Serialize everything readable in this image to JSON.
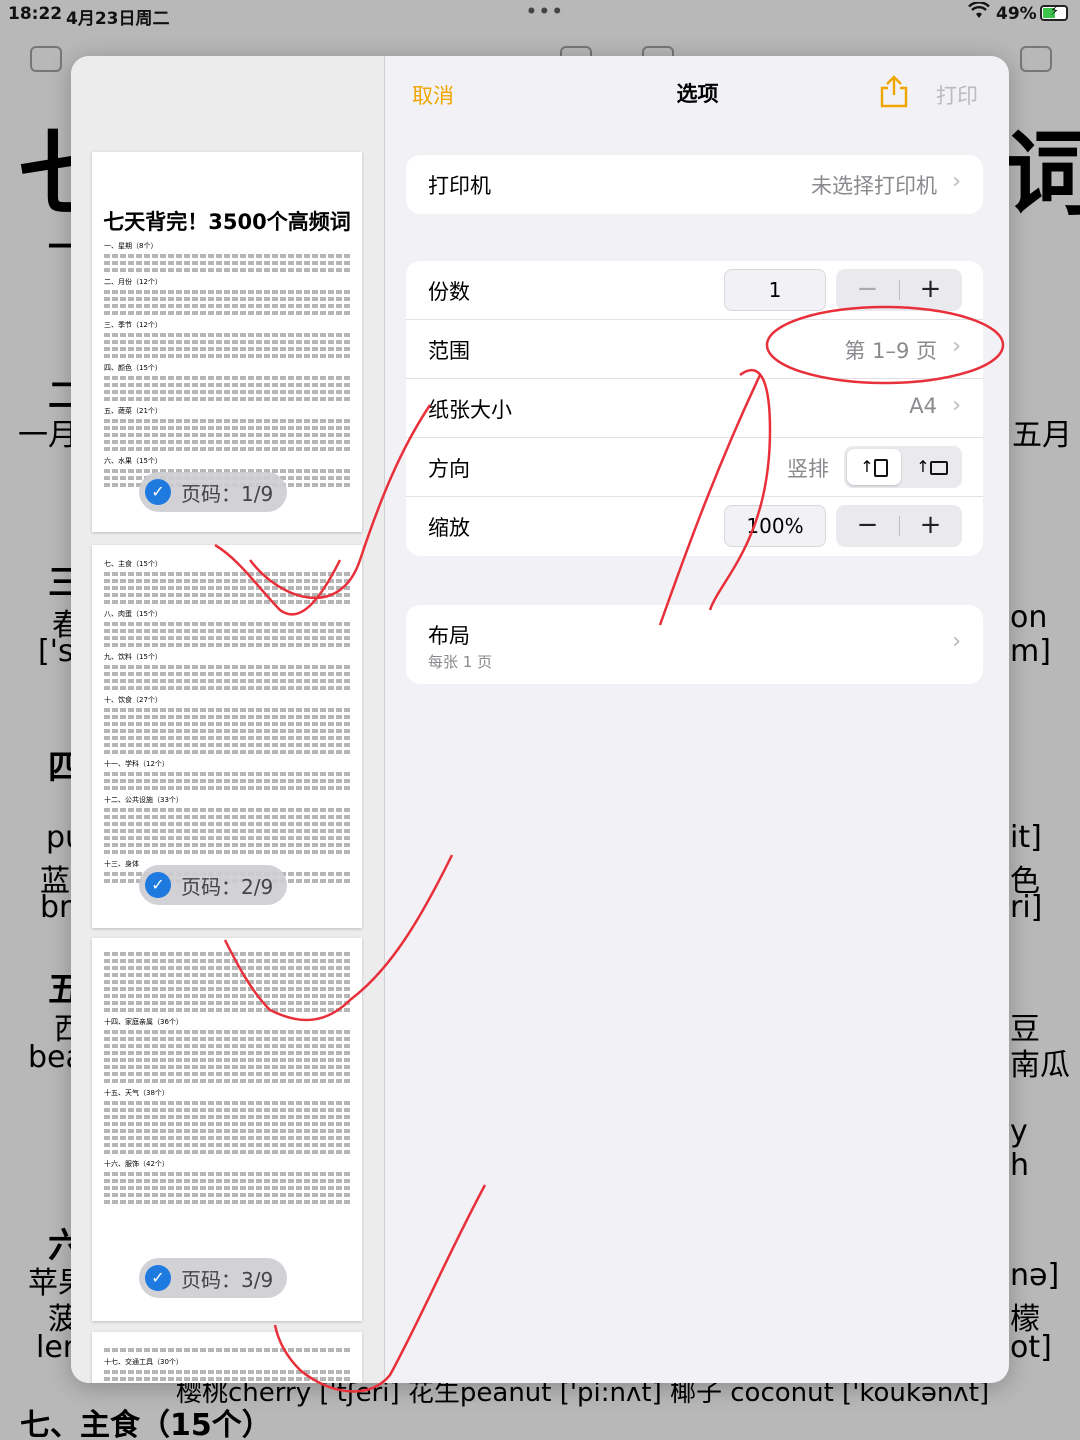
{
  "status_bar": {
    "time": "18:22",
    "date": "4月23日周二",
    "battery": "49%"
  },
  "background": {
    "title_fragment_left": "七",
    "title_fragment_right": "词",
    "left_fragments": [
      "一",
      "二",
      "一月",
      "三",
      "春",
      "['si",
      "四",
      "pu",
      "蓝",
      "bro",
      "五",
      "西",
      "bea",
      "六",
      "苹果",
      "菠",
      "lem"
    ],
    "right_fragments": [
      "五月",
      "on",
      "m]",
      "it]",
      "色",
      "ri]",
      "豆",
      "南瓜",
      "y",
      "h",
      "nə]",
      "檬",
      "ot]"
    ],
    "bottom_line": "樱桃cherry ['tʃeri] 花生peanut ['pi:nʌt] 椰子 coconut ['koukənʌt]",
    "bottom_heading": "七、主食（15个）"
  },
  "sheet": {
    "cancel": "取消",
    "title": "选项",
    "print": "打印",
    "printer_label": "打印机",
    "printer_value": "未选择打印机",
    "copies_label": "份数",
    "copies_value": "1",
    "range_label": "范围",
    "range_value": "第 1–9 页",
    "paper_label": "纸张大小",
    "paper_value": "A4",
    "orientation_label": "方向",
    "orientation_value": "竖排",
    "scale_label": "缩放",
    "scale_value": "100%",
    "layout_label": "布局",
    "layout_sub": "每张 1 页"
  },
  "previews": {
    "page1_title": "七天背完！3500个高频词",
    "page1_sections": [
      "一、星期（8个）",
      "二、月份（12个）",
      "三、季节（12个）",
      "四、颜色（15个）",
      "五、蔬菜（21个）",
      "六、水果（15个）"
    ],
    "page2_sections": [
      "七、主食（15个）",
      "八、肉蛋（15个）",
      "九、饮料（15个）",
      "十、饮食（27个）",
      "十一、学科（12个）",
      "十二、公共设施（33个）",
      "十三、身体"
    ],
    "page3_sections": [
      "十四、家庭亲属（36个）",
      "十五、天气（38个）",
      "十六、服饰（42个）"
    ],
    "page4_sections": [
      "十七、交通工具（30个）"
    ],
    "badges": [
      "页码：1/9",
      "页码：2/9",
      "页码：3/9"
    ]
  },
  "colors": {
    "accent": "#f0a500",
    "badge_check": "#1f7ae0",
    "annotation": "#e8303a"
  }
}
